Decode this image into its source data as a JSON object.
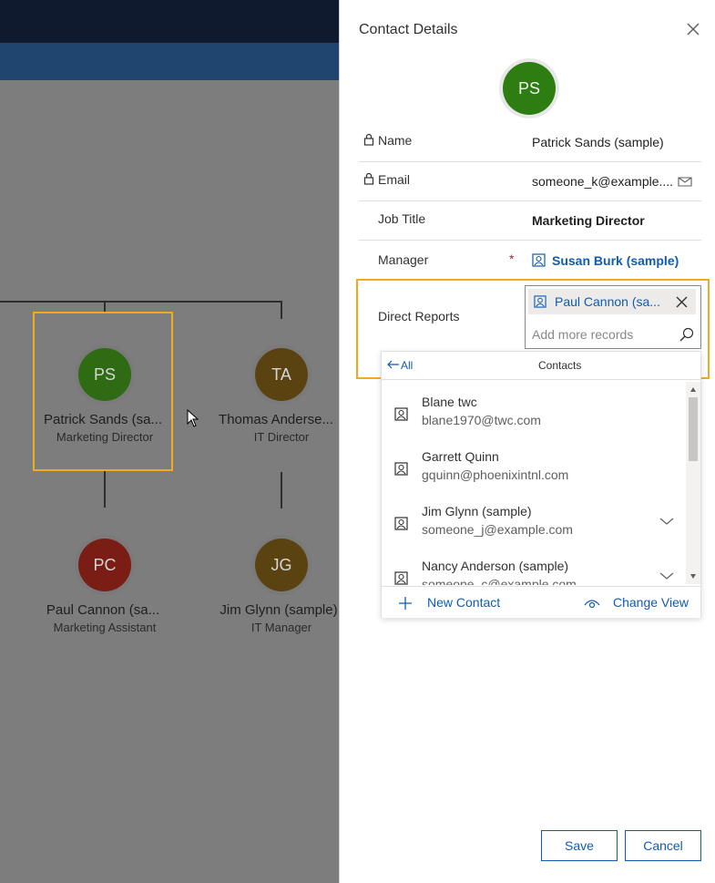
{
  "org_chart": {
    "nodes": [
      {
        "initials": "PS",
        "name": "Patrick Sands (sa...",
        "title": "Marketing Director",
        "color": "#2e6b12"
      },
      {
        "initials": "TA",
        "name": "Thomas Anderse...",
        "title": "IT Director",
        "color": "#5a4310"
      },
      {
        "initials": "PC",
        "name": "Paul Cannon (sa...",
        "title": "Marketing Assistant",
        "color": "#7a1d14"
      },
      {
        "initials": "JG",
        "name": "Jim Glynn (sample)",
        "title": "IT Manager",
        "color": "#5a4310"
      }
    ]
  },
  "panel": {
    "title": "Contact Details",
    "avatar_initials": "PS",
    "fields": {
      "name_label": "Name",
      "name_value": "Patrick Sands (sample)",
      "email_label": "Email",
      "email_value": "someone_k@example....",
      "job_title_label": "Job Title",
      "job_title_value": "Marketing Director",
      "manager_label": "Manager",
      "manager_required": "*",
      "manager_value": "Susan Burk (sample)",
      "direct_reports_label": "Direct Reports"
    },
    "lookup": {
      "selected_tag": "Paul Cannon (sa...",
      "placeholder": "Add more records",
      "back_label": "All",
      "view_label": "Contacts",
      "results": [
        {
          "name": "Blane twc",
          "email": "blane1970@twc.com"
        },
        {
          "name": "Garrett Quinn",
          "email": "gquinn@phoenixintnl.com"
        },
        {
          "name": "Jim Glynn (sample)",
          "email": "someone_j@example.com"
        },
        {
          "name": "Nancy Anderson (sample)",
          "email": "someone_c@example.com"
        }
      ],
      "new_contact_label": "New Contact",
      "change_view_label": "Change View"
    },
    "save_label": "Save",
    "cancel_label": "Cancel"
  },
  "colors": {
    "accent": "#0f5bb5",
    "highlight": "#f2a81f"
  }
}
